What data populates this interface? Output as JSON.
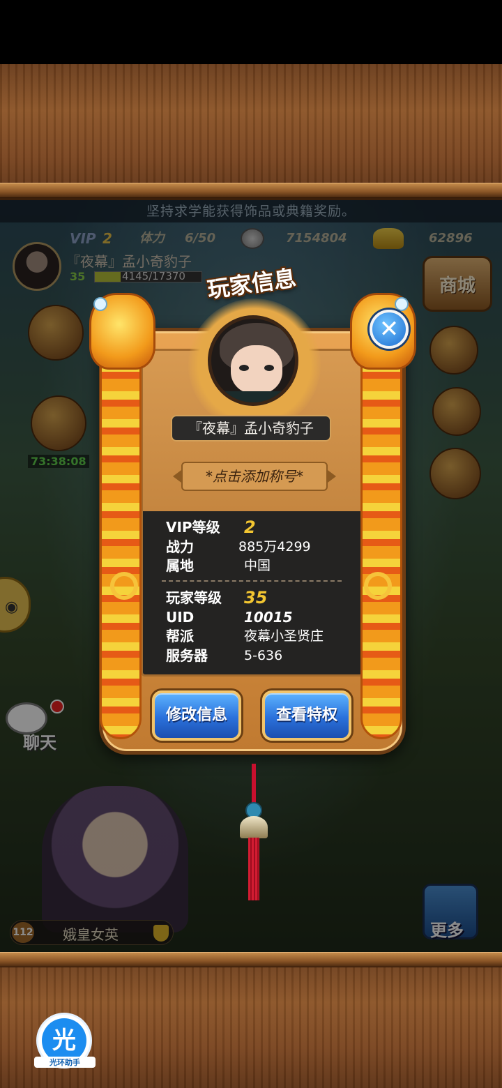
{
  "hint_bar": "坚持求学能获得饰品或典籍奖励。",
  "resources": {
    "vip_label": "VIP",
    "vip_value": "2",
    "stamina_label": "体力",
    "stamina_value": "6/50",
    "silver_value": "7154804",
    "gold_value": "62896"
  },
  "player_header": {
    "name": "『夜幕』孟小奇豹子",
    "level": "35",
    "exp": "4145/17370",
    "exp_fraction": 0.24
  },
  "side_menu": {
    "shop": "商城",
    "chat": "聊天",
    "more": "更多",
    "timer": "73:38:08"
  },
  "bottom_character": {
    "level": "112",
    "name": "娥皇女英"
  },
  "dialog": {
    "title": "玩家信息",
    "player_name": "『夜幕』孟小奇豹子",
    "add_title": "*点击添加称号*",
    "info_top": [
      {
        "label": "VIP等级",
        "value": "2"
      },
      {
        "label": "战力",
        "value": "885万4299"
      },
      {
        "label": "属地",
        "value": "中国"
      }
    ],
    "info_bottom": [
      {
        "label": "玩家等级",
        "value": "35"
      },
      {
        "label": "UID",
        "value": "10015"
      },
      {
        "label": "帮派",
        "value": "夜幕小圣贤庄"
      },
      {
        "label": "服务器",
        "value": "5-636"
      }
    ],
    "edit_button": "修改信息",
    "privilege_button": "查看特权",
    "close_glyph": "✕"
  },
  "helper": {
    "glyph": "光",
    "name": "光环助手"
  },
  "colors": {
    "wood": "#7a4520",
    "panel": "#e9a453",
    "button_blue": "#2a71db",
    "vip_gold": "#f3c631"
  }
}
